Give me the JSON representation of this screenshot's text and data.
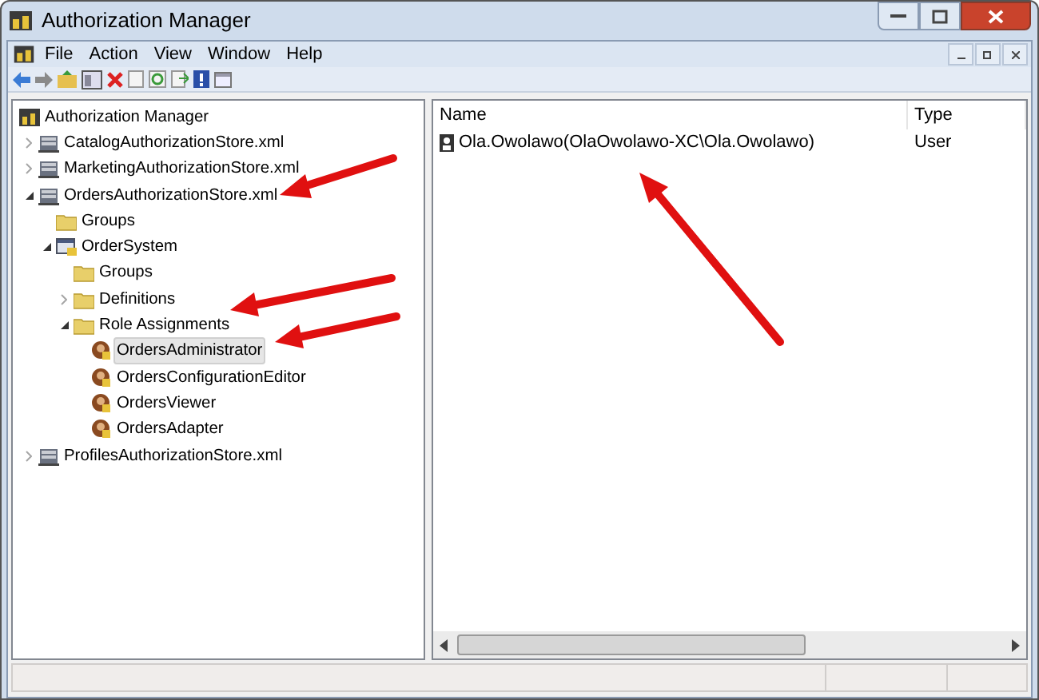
{
  "window": {
    "title": "Authorization Manager"
  },
  "menu": [
    {
      "label": "File"
    },
    {
      "label": "Action"
    },
    {
      "label": "View"
    },
    {
      "label": "Window"
    },
    {
      "label": "Help"
    }
  ],
  "tree": [
    {
      "label": "Authorization Manager",
      "kind": "root",
      "selected": false,
      "children": [
        {
          "label": "CatalogAuthorizationStore.xml",
          "kind": "store",
          "expanded": false,
          "selected": false
        },
        {
          "label": "MarketingAuthorizationStore.xml",
          "kind": "store",
          "expanded": false,
          "selected": false
        },
        {
          "label": "OrdersAuthorizationStore.xml",
          "kind": "store",
          "expanded": true,
          "selected": false,
          "children": [
            {
              "label": "Groups",
              "kind": "folder",
              "selected": false
            },
            {
              "label": "OrderSystem",
              "kind": "application",
              "expanded": true,
              "selected": false,
              "children": [
                {
                  "label": "Groups",
                  "kind": "folder",
                  "selected": false
                },
                {
                  "label": "Definitions",
                  "kind": "folder",
                  "expanded": false,
                  "selected": false
                },
                {
                  "label": "Role Assignments",
                  "kind": "folder",
                  "expanded": true,
                  "selected": false,
                  "children": [
                    {
                      "label": "OrdersAdministrator",
                      "kind": "role",
                      "selected": true
                    },
                    {
                      "label": "OrdersConfigurationEditor",
                      "kind": "role",
                      "selected": false
                    },
                    {
                      "label": "OrdersViewer",
                      "kind": "role",
                      "selected": false
                    },
                    {
                      "label": "OrdersAdapter",
                      "kind": "role",
                      "selected": false
                    }
                  ]
                }
              ]
            }
          ]
        },
        {
          "label": "ProfilesAuthorizationStore.xml",
          "kind": "store",
          "expanded": false,
          "selected": false
        }
      ]
    }
  ],
  "list": {
    "columns": [
      "Name",
      "Type"
    ],
    "rows": [
      [
        "Ola.Owolawo(OlaOwolawo-XC\\Ola.Owolawo)",
        "User"
      ]
    ]
  }
}
